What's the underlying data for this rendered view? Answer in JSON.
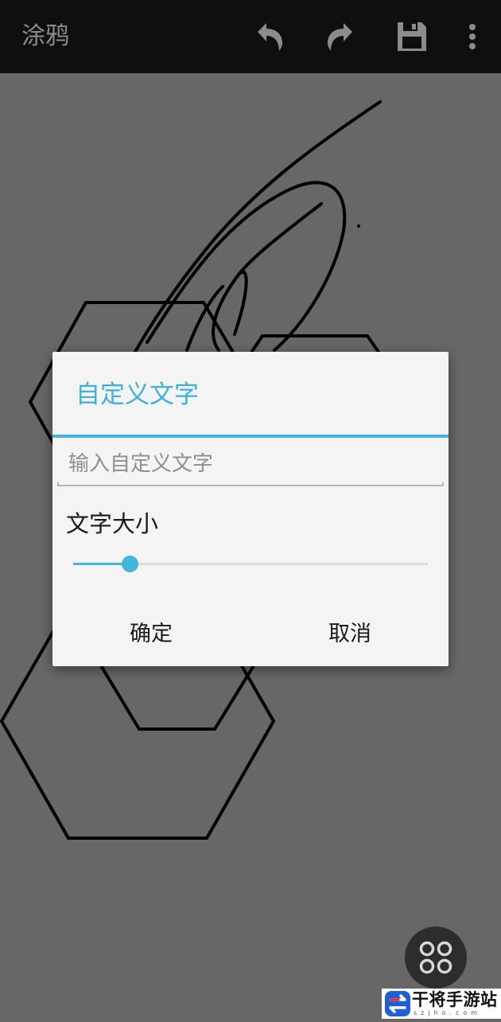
{
  "toolbar": {
    "title": "涂鸦",
    "actions": [
      {
        "name": "undo",
        "icon": "undo-icon"
      },
      {
        "name": "redo",
        "icon": "redo-icon"
      },
      {
        "name": "save",
        "icon": "save-icon"
      },
      {
        "name": "more",
        "icon": "more-vert-icon"
      }
    ]
  },
  "dialog": {
    "title": "自定义文字",
    "input_value": "",
    "input_placeholder": "输入自定义文字",
    "size_label": "文字大小",
    "size_slider_value": 0.16,
    "confirm_label": "确定",
    "cancel_label": "取消"
  },
  "fab": {
    "icon": "grid-circles-icon"
  },
  "watermark": {
    "text": "干将手游站",
    "sub": "szjho.com",
    "logo": "swap-arrows-logo"
  },
  "colors": {
    "toolbar_bg": "#0f0f0f",
    "canvas_bg": "#676767",
    "accent": "#45b5dc",
    "dialog_bg": "#f4f4f4"
  }
}
